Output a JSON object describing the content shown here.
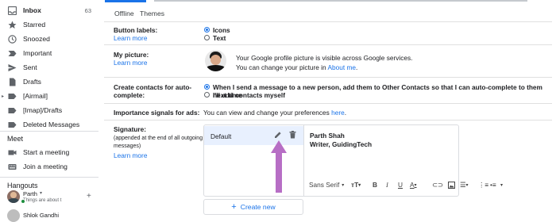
{
  "sidebar": {
    "items": [
      {
        "label": "Inbox",
        "count": "63",
        "icon": "inbox-icon"
      },
      {
        "label": "Starred",
        "icon": "star-icon"
      },
      {
        "label": "Snoozed",
        "icon": "clock-icon"
      },
      {
        "label": "Important",
        "icon": "important-icon"
      },
      {
        "label": "Sent",
        "icon": "send-icon"
      },
      {
        "label": "Drafts",
        "icon": "draft-icon"
      },
      {
        "label": "[Airmail]",
        "icon": "label-icon"
      },
      {
        "label": "[Imap]/Drafts",
        "icon": "label-icon"
      },
      {
        "label": "Deleted Messages",
        "icon": "label-icon"
      }
    ],
    "meet_title": "Meet",
    "meet_items": [
      {
        "label": "Start a meeting",
        "icon": "video-icon"
      },
      {
        "label": "Join a meeting",
        "icon": "keyboard-icon"
      }
    ],
    "hangouts_title": "Hangouts",
    "hangouts_user": {
      "name": "Parth",
      "status": "Things are about t"
    },
    "contact_name": "Shlok Gandhi"
  },
  "tabs": {
    "offline": "Offline",
    "themes": "Themes"
  },
  "settings": {
    "button_labels": {
      "label": "Button labels:",
      "link": "Learn more",
      "options": [
        "Icons",
        "Text"
      ]
    },
    "my_picture": {
      "label": "My picture:",
      "link": "Learn more",
      "line1": "Your Google profile picture is visible across Google services.",
      "line2_prefix": "You can change your picture in ",
      "line2_link": "About me",
      "line2_suffix": "."
    },
    "create_contacts": {
      "label_line1": "Create contacts for auto-",
      "label_line2": "complete:",
      "option1": "When I send a message to a new person, add them to Other Contacts so that I can auto-complete to them next time",
      "option2": "I'll add contacts myself"
    },
    "ads": {
      "label": "Importance signals for ads:",
      "text_prefix": "You can view and change your preferences ",
      "link": "here",
      "text_suffix": "."
    },
    "signature": {
      "label": "Signature:",
      "sub1": "(appended at the end of all outgoing",
      "sub2": "messages)",
      "link": "Learn more",
      "item": "Default",
      "sig_line1": "Parth Shah",
      "sig_line2": "Writer, GuidingTech",
      "font": "Sans Serif",
      "create_button": "Create new"
    }
  },
  "colors": {
    "accent": "#1a73e8",
    "arrow": "#b76ec5"
  }
}
